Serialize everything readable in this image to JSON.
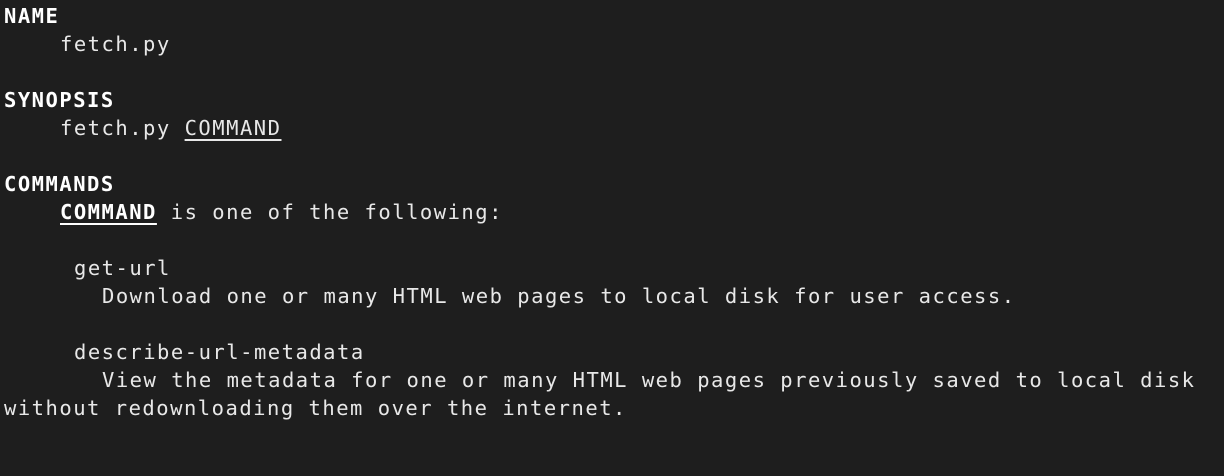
{
  "sections": {
    "name": {
      "heading": "NAME",
      "program": "fetch.py"
    },
    "synopsis": {
      "heading": "SYNOPSIS",
      "program": "fetch.py",
      "argument": "COMMAND"
    },
    "commands": {
      "heading": "COMMANDS",
      "intro_keyword": "COMMAND",
      "intro_rest": " is one of the following:",
      "items": [
        {
          "name": "get-url",
          "description": "Download one or many HTML web pages to local disk for user access."
        },
        {
          "name": "describe-url-metadata",
          "description": "View the metadata for one or many HTML web pages previously saved to local disk",
          "description_continued": "without redownloading them over the internet."
        }
      ]
    }
  }
}
